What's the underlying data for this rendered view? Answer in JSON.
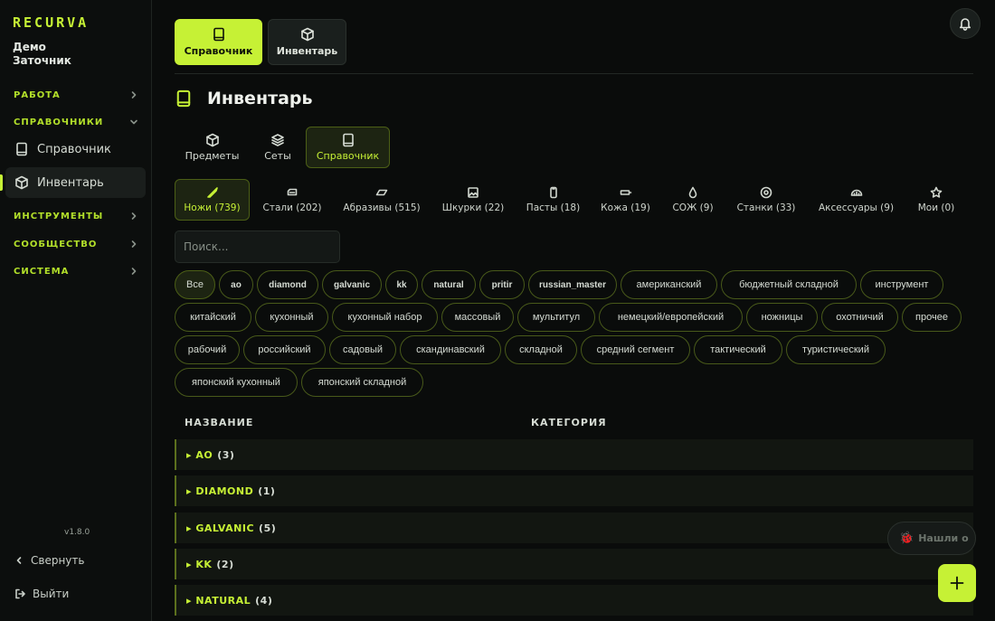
{
  "sidebar": {
    "logo": "RECURVA",
    "user_line1": "Демо",
    "user_line2": "Заточник",
    "sections": {
      "work": "РАБОТА",
      "refs": "СПРАВОЧНИКИ",
      "tools": "ИНСТРУМЕНТЫ",
      "community": "СООБЩЕСТВО",
      "system": "СИСТЕМА"
    },
    "items": {
      "reference": "Справочник",
      "inventory": "Инвентарь"
    },
    "version": "v1.8.0",
    "collapse": "Свернуть",
    "logout": "Выйти"
  },
  "topnav": {
    "reference": "Справочник",
    "inventory": "Инвентарь"
  },
  "page": {
    "title": "Инвентарь"
  },
  "subtabs": {
    "items": "Предметы",
    "sets": "Сеты",
    "reference": "Справочник"
  },
  "categories": {
    "knives": "Ножи (739)",
    "steels": "Стали (202)",
    "abrasives": "Абразивы (515)",
    "sandpaper": "Шкурки (22)",
    "pastes": "Пасты (18)",
    "leather": "Кожа (19)",
    "coolant": "СОЖ (9)",
    "machines": "Станки (33)",
    "accessories": "Аксессуары (9)",
    "mine": "Мои (0)"
  },
  "search": {
    "placeholder": "Поиск..."
  },
  "tags": [
    "Все",
    "ao",
    "diamond",
    "galvanic",
    "kk",
    "natural",
    "pritir",
    "russian_master",
    "американский",
    "бюджетный складной",
    "инструмент",
    "китайский",
    "кухонный",
    "кухонный набор",
    "массовый",
    "мультитул",
    "немецкий/европейский",
    "ножницы",
    "охотничий",
    "прочее",
    "рабочий",
    "российский",
    "садовый",
    "скандинавский",
    "складной",
    "средний сегмент",
    "тактический",
    "туристический",
    "японский кухонный",
    "японский складной"
  ],
  "table": {
    "col_name": "НАЗВАНИЕ",
    "col_category": "КАТЕГОРИЯ",
    "groups": [
      {
        "name": "▸ AO",
        "count": "(3)"
      },
      {
        "name": "▸ DIAMOND",
        "count": "(1)"
      },
      {
        "name": "▸ GALVANIC",
        "count": "(5)"
      },
      {
        "name": "▸ KK",
        "count": "(2)"
      },
      {
        "name": "▸ NATURAL",
        "count": "(4)"
      }
    ]
  },
  "bug_report": "Нашли о",
  "accent_color": "#c6f135"
}
